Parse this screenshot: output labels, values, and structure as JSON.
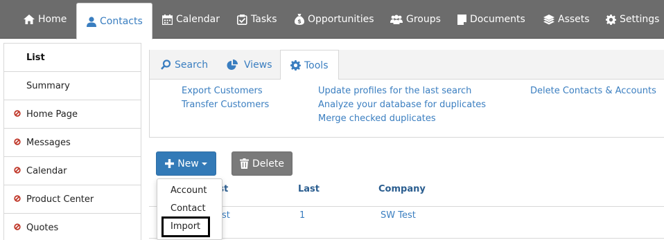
{
  "topnav": {
    "tabs": [
      {
        "label": "Home",
        "icon": "home-icon"
      },
      {
        "label": "Contacts",
        "icon": "user-icon",
        "active": true
      },
      {
        "label": "Calendar",
        "icon": "calendar-icon"
      },
      {
        "label": "Tasks",
        "icon": "checkbox-icon"
      },
      {
        "label": "Opportunities",
        "icon": "money-bag-icon"
      },
      {
        "label": "Groups",
        "icon": "group-icon"
      },
      {
        "label": "Documents",
        "icon": "document-icon"
      },
      {
        "label": "Assets",
        "icon": "layers-icon"
      },
      {
        "label": "Settings",
        "icon": "gear-icon"
      }
    ]
  },
  "sidebar": {
    "items": [
      {
        "label": "List",
        "active": true
      },
      {
        "label": "Summary"
      },
      {
        "label": "Home Page",
        "restricted": true
      },
      {
        "label": "Messages",
        "restricted": true
      },
      {
        "label": "Calendar",
        "restricted": true
      },
      {
        "label": "Product Center",
        "restricted": true
      },
      {
        "label": "Quotes",
        "restricted": true
      }
    ]
  },
  "subtabs": {
    "items": [
      {
        "label": "Search",
        "icon": "search-icon"
      },
      {
        "label": "Views",
        "icon": "pie-chart-icon"
      },
      {
        "label": "Tools",
        "icon": "gear-icon",
        "active": true
      }
    ]
  },
  "tools": {
    "export_customers": "Export Customers",
    "transfer_customers": "Transfer Customers",
    "update_profiles": "Update profiles for the last search",
    "analyze_duplicates": "Analyze your database for duplicates",
    "merge_duplicates": "Merge checked duplicates",
    "delete_contacts": "Delete Contacts & Accounts"
  },
  "buttons": {
    "new_label": "New",
    "delete_label": "Delete"
  },
  "new_menu": {
    "items": [
      "Account",
      "Contact",
      "Import"
    ]
  },
  "table": {
    "headers": [
      "First",
      "Last",
      "Company"
    ],
    "first_header_visible": "rst",
    "rows": [
      {
        "first_visible": "est",
        "last": "1",
        "company": "SW Test"
      }
    ]
  },
  "colors": {
    "nav_bg": "#6c6c6c",
    "link": "#3a7ec0",
    "primary_button": "#337ab7",
    "delete_button": "#7a7a7a",
    "restricted_icon": "#c0392b"
  }
}
